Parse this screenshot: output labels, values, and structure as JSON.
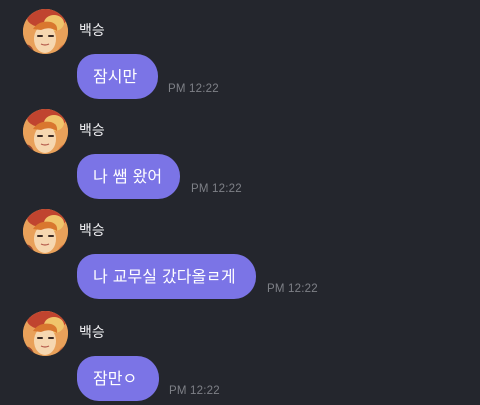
{
  "colors": {
    "background": "#24262d",
    "bubble": "#7b74e6",
    "bubble_text": "#ffffff",
    "sender_text": "#f1f1f4",
    "timestamp_text": "#7e8087"
  },
  "messages": [
    {
      "sender": "백승",
      "avatar_icon": "profile-photo-icon",
      "text": "잠시만",
      "time": "PM 12:22"
    },
    {
      "sender": "백승",
      "avatar_icon": "profile-photo-icon",
      "text": "나 쌤 왔어",
      "time": "PM 12:22"
    },
    {
      "sender": "백승",
      "avatar_icon": "profile-photo-icon",
      "text": "나 교무실 갔다올ㄹ게",
      "time": "PM 12:22"
    },
    {
      "sender": "백승",
      "avatar_icon": "profile-photo-icon",
      "text": "잠만ㅇ",
      "time": "PM 12:22"
    }
  ]
}
